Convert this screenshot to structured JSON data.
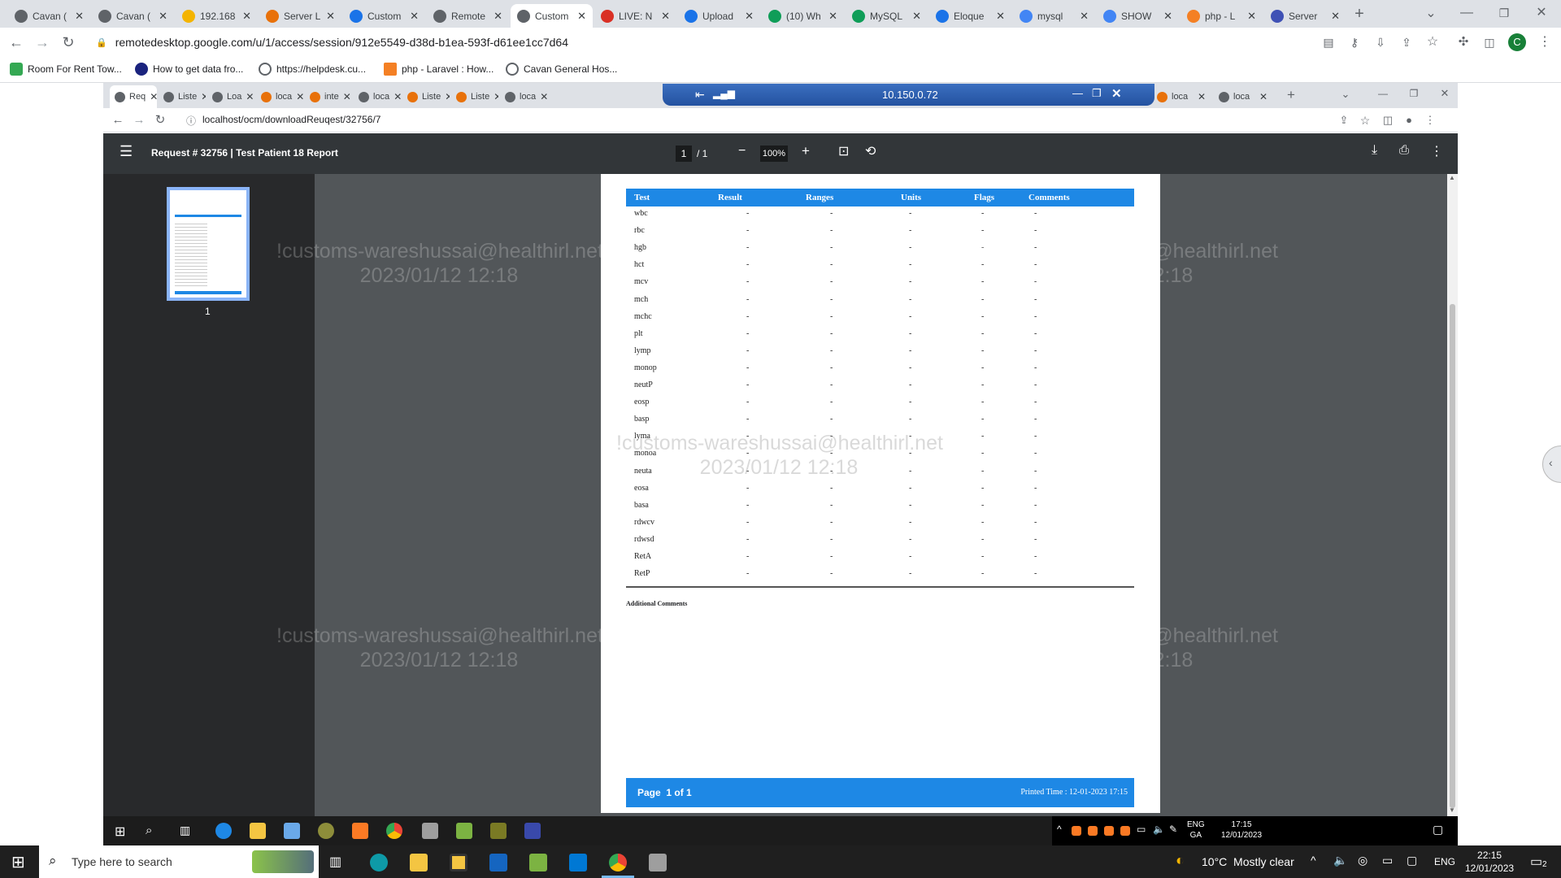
{
  "outer_browser": {
    "tabs": [
      {
        "label": "Cavan (",
        "color": "#5f6368"
      },
      {
        "label": "Cavan (",
        "color": "#5f6368"
      },
      {
        "label": "192.168",
        "color": "#f4b400"
      },
      {
        "label": "Server L",
        "color": "#e8710a"
      },
      {
        "label": "Custom",
        "color": "#1a73e8"
      },
      {
        "label": "Remote",
        "color": "#5f6368"
      },
      {
        "label": "Custom",
        "color": "#5f6368"
      },
      {
        "label": "LIVE: N",
        "color": "#d93025"
      },
      {
        "label": "Upload",
        "color": "#1a73e8"
      },
      {
        "label": "(10) Wh",
        "color": "#0f9d58"
      },
      {
        "label": "MySQL",
        "color": "#0f9d58"
      },
      {
        "label": "Eloque",
        "color": "#1a73e8"
      },
      {
        "label": "mysql",
        "color": "#4285f4"
      },
      {
        "label": "SHOW",
        "color": "#4285f4"
      },
      {
        "label": "php - L",
        "color": "#f48024"
      },
      {
        "label": "Server",
        "color": "#3f51b5"
      }
    ],
    "url": "remotedesktop.google.com/u/1/access/session/912e5549-d38d-b1ea-593f-d61ee1cc7d64",
    "profile_initial": "C",
    "bookmarks": [
      "Room For Rent Tow...",
      "How to get data fro...",
      "https://helpdesk.cu...",
      "php - Laravel : How...",
      "Cavan General Hos..."
    ]
  },
  "inner_browser": {
    "tabs": [
      "Req",
      "Liste",
      "Loa",
      "loca",
      "inte",
      "loca",
      "Liste",
      "Liste",
      "loca"
    ],
    "right_tabs": [
      "loca",
      "loca"
    ],
    "remote_host": "10.150.0.72",
    "url": "localhost/ocm/downloadReuqest/32756/7"
  },
  "pdf_viewer": {
    "title": "Request # 32756 | Test Patient 18 Report",
    "page_current": "1",
    "page_total": "/ 1",
    "zoom": "100%",
    "thumbnail_label": "1"
  },
  "report": {
    "columns": [
      "Test",
      "Result",
      "Ranges",
      "Units",
      "Flags",
      "Comments"
    ],
    "rows": [
      {
        "test": "wbc",
        "result": "-",
        "ranges": "-",
        "units": "-",
        "flags": "-",
        "comments": "-"
      },
      {
        "test": "rbc",
        "result": "-",
        "ranges": "-",
        "units": "-",
        "flags": "-",
        "comments": "-"
      },
      {
        "test": "hgb",
        "result": "-",
        "ranges": "-",
        "units": "-",
        "flags": "-",
        "comments": "-"
      },
      {
        "test": "hct",
        "result": "-",
        "ranges": "-",
        "units": "-",
        "flags": "-",
        "comments": "-"
      },
      {
        "test": "mcv",
        "result": "-",
        "ranges": "-",
        "units": "-",
        "flags": "-",
        "comments": "-"
      },
      {
        "test": "mch",
        "result": "-",
        "ranges": "-",
        "units": "-",
        "flags": "-",
        "comments": "-"
      },
      {
        "test": "mchc",
        "result": "-",
        "ranges": "-",
        "units": "-",
        "flags": "-",
        "comments": "-"
      },
      {
        "test": "plt",
        "result": "-",
        "ranges": "-",
        "units": "-",
        "flags": "-",
        "comments": "-"
      },
      {
        "test": "lymp",
        "result": "-",
        "ranges": "-",
        "units": "-",
        "flags": "-",
        "comments": "-"
      },
      {
        "test": "monop",
        "result": "-",
        "ranges": "-",
        "units": "-",
        "flags": "-",
        "comments": "-"
      },
      {
        "test": "neutP",
        "result": "-",
        "ranges": "-",
        "units": "-",
        "flags": "-",
        "comments": "-"
      },
      {
        "test": "eosp",
        "result": "-",
        "ranges": "-",
        "units": "-",
        "flags": "-",
        "comments": "-"
      },
      {
        "test": "basp",
        "result": "-",
        "ranges": "-",
        "units": "-",
        "flags": "-",
        "comments": "-"
      },
      {
        "test": "lyma",
        "result": "-",
        "ranges": "-",
        "units": "-",
        "flags": "-",
        "comments": "-"
      },
      {
        "test": "monoa",
        "result": "-",
        "ranges": "-",
        "units": "-",
        "flags": "-",
        "comments": "-"
      },
      {
        "test": "neuta",
        "result": "-",
        "ranges": "-",
        "units": "-",
        "flags": "-",
        "comments": "-"
      },
      {
        "test": "eosa",
        "result": "-",
        "ranges": "-",
        "units": "-",
        "flags": "-",
        "comments": "-"
      },
      {
        "test": "basa",
        "result": "-",
        "ranges": "-",
        "units": "-",
        "flags": "-",
        "comments": "-"
      },
      {
        "test": "rdwcv",
        "result": "-",
        "ranges": "-",
        "units": "-",
        "flags": "-",
        "comments": "-"
      },
      {
        "test": "rdwsd",
        "result": "-",
        "ranges": "-",
        "units": "-",
        "flags": "-",
        "comments": "-"
      },
      {
        "test": "RetA",
        "result": "-",
        "ranges": "-",
        "units": "-",
        "flags": "-",
        "comments": "-"
      },
      {
        "test": "RetP",
        "result": "-",
        "ranges": "-",
        "units": "-",
        "flags": "-",
        "comments": "-"
      }
    ],
    "additional_comments_label": "Additional Comments",
    "footer_page": "Page  1 of 1",
    "footer_printed": "Printed Time : 12-01-2023 17:15"
  },
  "watermark": {
    "line1": "!customs-wareshussai@healthirl.net",
    "line2": "2023/01/12 12:18"
  },
  "remote_taskbar": {
    "lang_line1": "ENG",
    "lang_line2": "GA",
    "time": "17:15",
    "date": "12/01/2023"
  },
  "local_taskbar": {
    "search_placeholder": "Type here to search",
    "weather": "10°C  Mostly clear",
    "lang": "ENG",
    "time": "22:15",
    "date": "12/01/2023",
    "notification_count": "2"
  }
}
